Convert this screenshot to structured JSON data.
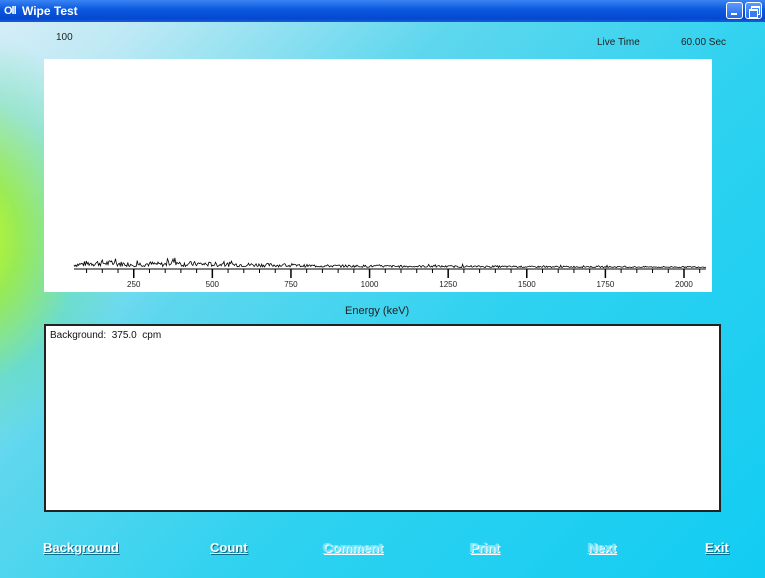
{
  "window": {
    "title": "Wipe Test",
    "app_icon_glyph": "Oll"
  },
  "spectrum": {
    "y_max_label": "100",
    "live_time_label": "Live Time",
    "live_time_value": "60.00  Sec",
    "x_axis_label": "Energy (keV)",
    "tick_labels": [
      "250",
      "500",
      "750",
      "1000",
      "1250",
      "1500",
      "1750",
      "2000"
    ]
  },
  "chart_data": {
    "type": "line",
    "xlabel": "Energy (keV)",
    "ylabel": "",
    "xlim": [
      60,
      2070
    ],
    "ylim": [
      0,
      100
    ],
    "x_ticks": [
      250,
      500,
      750,
      1000,
      1250,
      1500,
      1750,
      2000
    ],
    "series": [
      {
        "x": [
          60,
          100,
          150,
          200,
          250,
          300,
          350,
          380,
          400,
          450,
          500,
          550,
          600,
          650,
          700,
          750,
          800,
          900,
          1000,
          1100,
          1200,
          1300,
          1400,
          1500,
          1600,
          1700,
          1800,
          1900,
          2000,
          2070
        ],
        "y": [
          1.5,
          2.2,
          2.5,
          2.1,
          1.8,
          2.0,
          1.7,
          3.4,
          1.9,
          2.0,
          1.8,
          1.7,
          1.6,
          1.5,
          1.4,
          1.2,
          1.1,
          1.0,
          0.9,
          0.8,
          0.8,
          0.7,
          0.7,
          0.6,
          0.6,
          0.6,
          0.5,
          0.5,
          0.5,
          0.5
        ]
      }
    ]
  },
  "report": {
    "text": "Background:  375.0  cpm"
  },
  "buttons": {
    "background": "Background",
    "count": "Count",
    "comment": "Comment",
    "print": "Print",
    "next": "Next",
    "exit": "Exit"
  },
  "colors": {
    "title_bar": "#0a57de",
    "background_gradient_start": "#bde9f4",
    "background_gradient_end": "#12ccf2",
    "accent_corner": "#d2ff14",
    "enabled_button_text": "#ffffff",
    "disabled_button_text": "#7fe4f5"
  },
  "icons": {
    "minimize": "minimize-icon",
    "restore": "restore-icon"
  }
}
